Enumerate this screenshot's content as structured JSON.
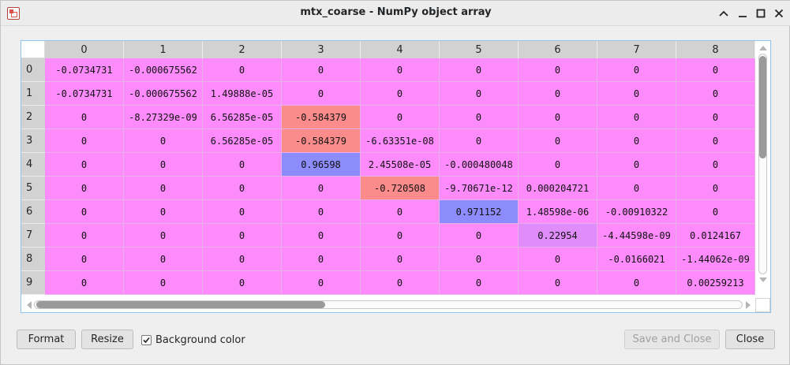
{
  "window": {
    "title": "mtx_coarse - NumPy object array"
  },
  "table": {
    "columns": [
      "0",
      "1",
      "2",
      "3",
      "4",
      "5",
      "6",
      "7",
      "8"
    ],
    "rows": [
      "0",
      "1",
      "2",
      "3",
      "4",
      "5",
      "6",
      "7",
      "8",
      "9"
    ],
    "cells": [
      [
        "-0.0734731",
        "-0.000675562",
        "0",
        "0",
        "0",
        "0",
        "0",
        "0",
        "0"
      ],
      [
        "-0.0734731",
        "-0.000675562",
        "1.49888e-05",
        "0",
        "0",
        "0",
        "0",
        "0",
        "0"
      ],
      [
        "0",
        "-8.27329e-09",
        "6.56285e-05",
        "-0.584379",
        "0",
        "0",
        "0",
        "0",
        "0"
      ],
      [
        "0",
        "0",
        "6.56285e-05",
        "-0.584379",
        "-6.63351e-08",
        "0",
        "0",
        "0",
        "0"
      ],
      [
        "0",
        "0",
        "0",
        "0.96598",
        "2.45508e-05",
        "-0.000480048",
        "0",
        "0",
        "0"
      ],
      [
        "0",
        "0",
        "0",
        "0",
        "-0.720508",
        "-9.70671e-12",
        "0.000204721",
        "0",
        "0"
      ],
      [
        "0",
        "0",
        "0",
        "0",
        "0",
        "0.971152",
        "1.48598e-06",
        "-0.00910322",
        "0"
      ],
      [
        "0",
        "0",
        "0",
        "0",
        "0",
        "0",
        "0.22954",
        "-4.44598e-09",
        "0.0124167"
      ],
      [
        "0",
        "0",
        "0",
        "0",
        "0",
        "0",
        "0",
        "-0.0166021",
        "-1.44062e-09"
      ],
      [
        "0",
        "0",
        "0",
        "0",
        "0",
        "0",
        "0",
        "0",
        "0.00259213"
      ]
    ],
    "bg_colors": [
      [
        "#fd8bfb",
        "#fd8bfb",
        "#fd8bfb",
        "#fd8bfb",
        "#fd8bfb",
        "#fd8bfb",
        "#fd8bfb",
        "#fd8bfb",
        "#fd8bfb"
      ],
      [
        "#fd8bfb",
        "#fd8bfb",
        "#fd8bfb",
        "#fd8bfb",
        "#fd8bfb",
        "#fd8bfb",
        "#fd8bfb",
        "#fd8bfb",
        "#fd8bfb"
      ],
      [
        "#fd8bfb",
        "#fd8bfb",
        "#fd8bfb",
        "#fc8c8c",
        "#fd8bfb",
        "#fd8bfb",
        "#fd8bfb",
        "#fd8bfb",
        "#fd8bfb"
      ],
      [
        "#fd8bfb",
        "#fd8bfb",
        "#fd8bfb",
        "#fc8c8c",
        "#fd8bfb",
        "#fd8bfb",
        "#fd8bfb",
        "#fd8bfb",
        "#fd8bfb"
      ],
      [
        "#fd8bfb",
        "#fd8bfb",
        "#fd8bfb",
        "#8c8cfc",
        "#fd8bfb",
        "#fd8bfb",
        "#fd8bfb",
        "#fd8bfb",
        "#fd8bfb"
      ],
      [
        "#fd8bfb",
        "#fd8bfb",
        "#fd8bfb",
        "#fd8bfb",
        "#fc8c8c",
        "#fd8bfb",
        "#fd8bfb",
        "#fd8bfb",
        "#fd8bfb"
      ],
      [
        "#fd8bfb",
        "#fd8bfb",
        "#fd8bfb",
        "#fd8bfb",
        "#fd8bfb",
        "#8c8cfc",
        "#fd8bfb",
        "#fd8bfb",
        "#fd8bfb"
      ],
      [
        "#fd8bfb",
        "#fd8bfb",
        "#fd8bfb",
        "#fd8bfb",
        "#fd8bfb",
        "#fd8bfb",
        "#e18cfb",
        "#fd8bfb",
        "#fd8bfb"
      ],
      [
        "#fd8bfb",
        "#fd8bfb",
        "#fd8bfb",
        "#fd8bfb",
        "#fd8bfb",
        "#fd8bfb",
        "#fd8bfb",
        "#fd8bfb",
        "#fd8bfb"
      ],
      [
        "#fd8bfb",
        "#fd8bfb",
        "#fd8bfb",
        "#fd8bfb",
        "#fd8bfb",
        "#fd8bfb",
        "#fd8bfb",
        "#fd8bfb",
        "#fd8bfb"
      ]
    ]
  },
  "footer": {
    "format_label": "Format",
    "resize_label": "Resize",
    "bg_color_label": "Background color",
    "bg_color_checked": true,
    "save_close_label": "Save and Close",
    "close_label": "Close"
  },
  "icons": {
    "app": "spyder-app-icon",
    "titlebar": [
      "chevron-up-icon",
      "minimize-icon",
      "maximize-icon",
      "close-icon"
    ],
    "checkbox": "checkmark-icon"
  }
}
